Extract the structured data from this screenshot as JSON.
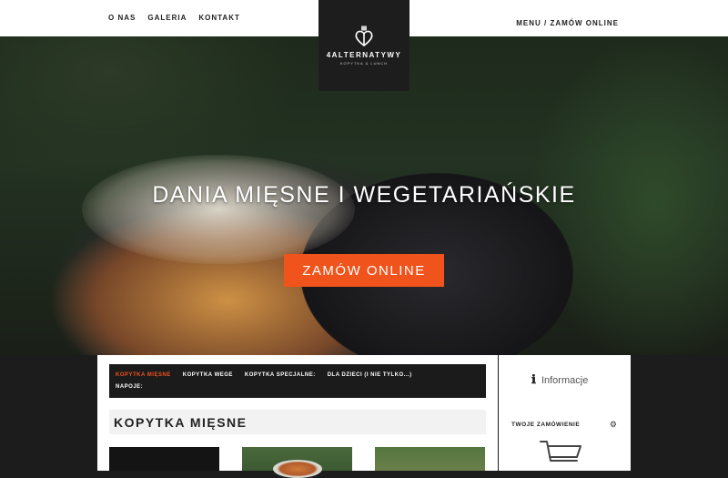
{
  "nav": {
    "left": [
      "O NAS",
      "GALERIA",
      "KONTAKT"
    ],
    "right": "MENU / ZAMÓW ONLINE"
  },
  "logo": {
    "brand": "4ALTERNATYWY",
    "tagline": "KOPYTKA & LUNCH"
  },
  "hero": {
    "heading": "DANIA MIĘSNE I WEGETARIAŃSKIE",
    "cta": "ZAMÓW ONLINE"
  },
  "categories": {
    "row1": [
      "KOPYTKA MIĘSNE",
      "KOPYTKA WEGE",
      "KOPYTKA SPECJALNE:",
      "DLA DZIECI (I NIE TYLKO...)"
    ],
    "row2": [
      "NAPOJE:"
    ],
    "active_index": 0
  },
  "section": {
    "title": "KOPYTKA MIĘSNE"
  },
  "sidebar": {
    "info_label": "Informacje",
    "order_label": "TWOJE ZAMÓWIENIE"
  },
  "colors": {
    "accent": "#f0531c",
    "dark": "#1b1b1b"
  },
  "icons": {
    "info": "info-icon",
    "settings": "gear-icon",
    "cart": "cart-icon"
  }
}
